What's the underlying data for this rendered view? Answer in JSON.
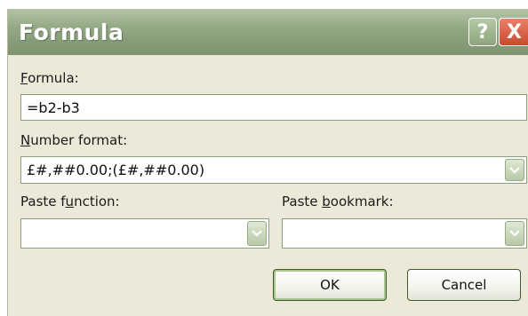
{
  "dialog": {
    "title": "Formula",
    "help_glyph": "?",
    "close_glyph": "X",
    "icons": {
      "help": "help-icon",
      "close": "close-icon",
      "dropdown": "chevron-down-icon"
    }
  },
  "formula": {
    "label_accel": "F",
    "label_rest": "ormula:",
    "value": "=b2-b3"
  },
  "number_format": {
    "label_accel": "N",
    "label_rest": "umber format:",
    "value": "£#,##0.00;(£#,##0.00)"
  },
  "paste_function": {
    "label_pre": "Paste f",
    "label_accel": "u",
    "label_post": "nction:",
    "value": ""
  },
  "paste_bookmark": {
    "label_pre": "Paste ",
    "label_accel": "b",
    "label_post": "ookmark:",
    "value": ""
  },
  "buttons": {
    "ok": "OK",
    "cancel": "Cancel"
  },
  "colors": {
    "titlebar": "#879d79",
    "dialog_bg": "#ece9d8",
    "close_button": "#c8492c"
  }
}
